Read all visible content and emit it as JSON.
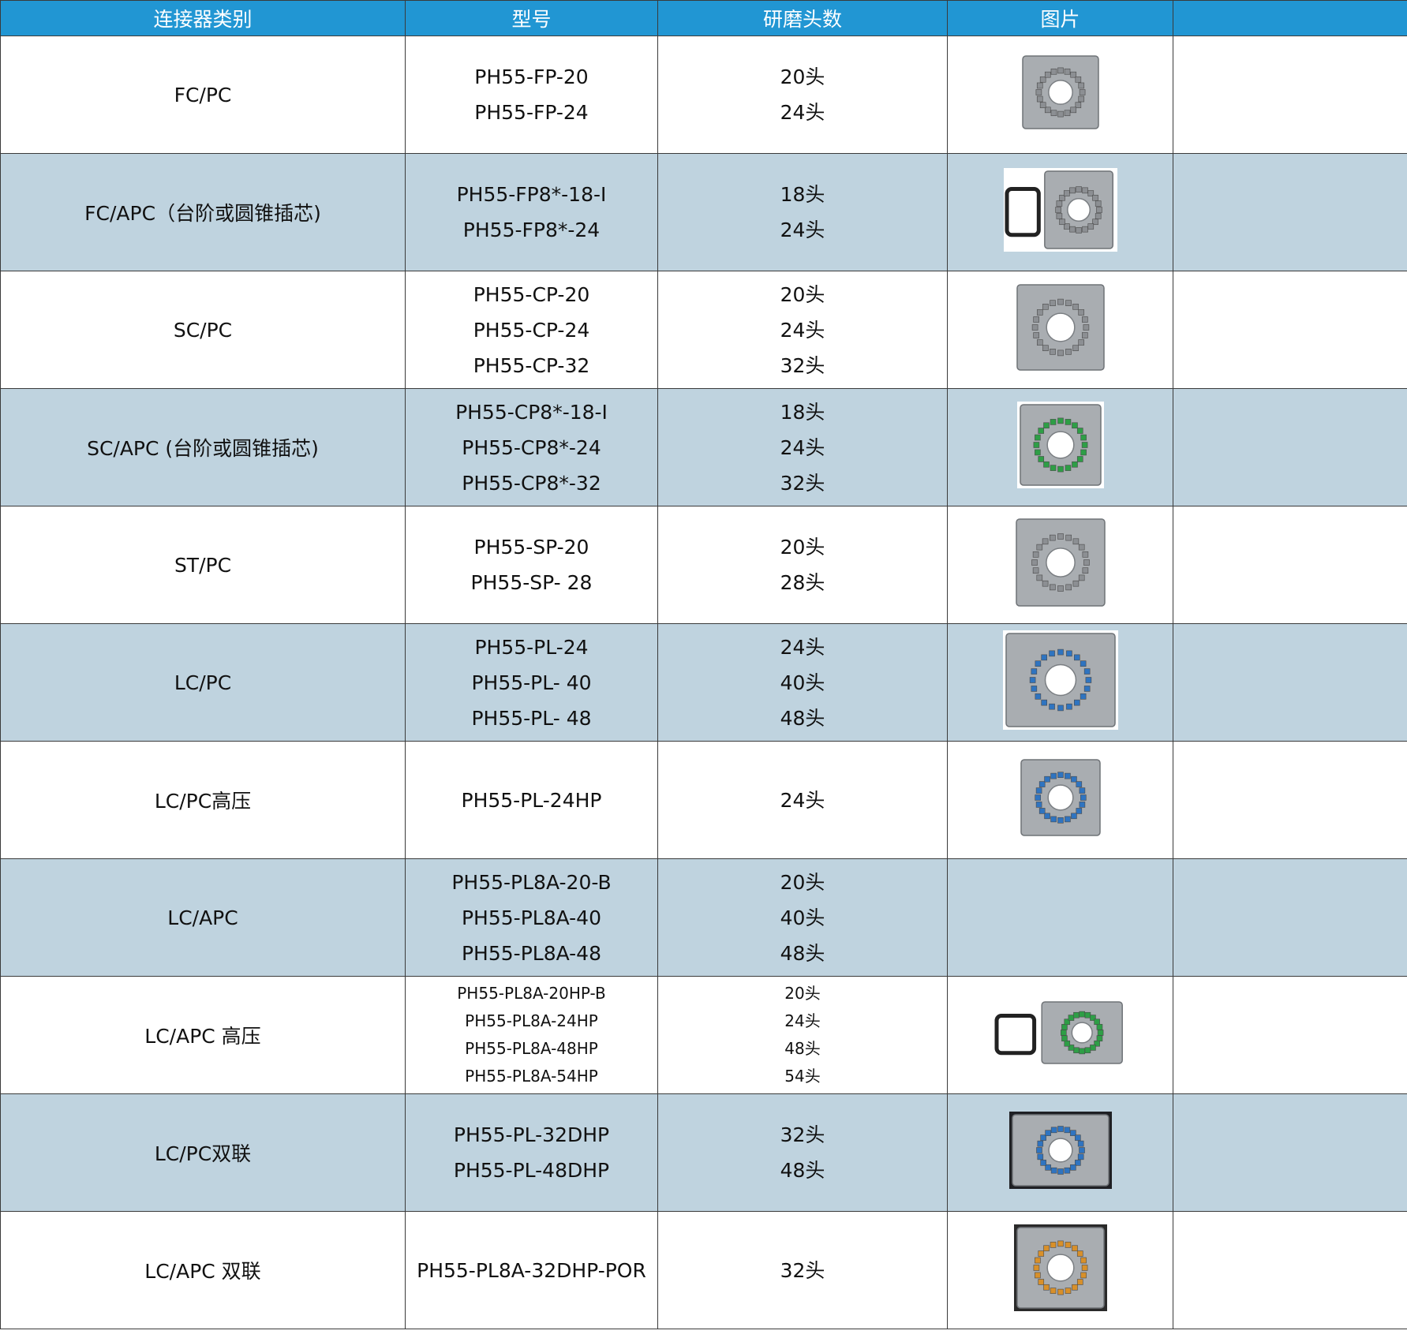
{
  "headers": [
    "连接器类别",
    "型号",
    "研磨头数",
    "图片",
    ""
  ],
  "rows": [
    {
      "category": "FC/PC",
      "models": [
        "PH55-FP-20",
        "PH55-FP-24"
      ],
      "heads": [
        "20头",
        "24头"
      ],
      "image": "fixture-photo-gray"
    },
    {
      "category": "FC/APC（台阶或圆锥插芯)",
      "models": [
        "PH55-FP8*-18-I",
        "PH55-FP8*-24"
      ],
      "heads": [
        "18头",
        "24头"
      ],
      "image": "fixture-photo-with-handle"
    },
    {
      "category": "SC/PC",
      "models": [
        "PH55-CP-20",
        "PH55-CP-24",
        "PH55-CP-32"
      ],
      "heads": [
        "20头",
        "24头",
        "32头"
      ],
      "image": "fixture-photo-gray"
    },
    {
      "category": "SC/APC (台阶或圆锥插芯)",
      "models": [
        "PH55-CP8*-18-I",
        "PH55-CP8*-24",
        "PH55-CP8*-32"
      ],
      "heads": [
        "18头",
        "24头",
        "32头"
      ],
      "image": "fixture-photo-green"
    },
    {
      "category": "ST/PC",
      "models": [
        "PH55-SP-20",
        "PH55-SP- 28"
      ],
      "heads": [
        "20头",
        "28头"
      ],
      "image": "fixture-photo-gray"
    },
    {
      "category": "LC/PC",
      "models": [
        "PH55-PL-24",
        "PH55-PL- 40",
        "PH55-PL- 48"
      ],
      "heads": [
        "24头",
        "40头",
        "48头"
      ],
      "image": "fixture-photo-blue"
    },
    {
      "category": "LC/PC高压",
      "models": [
        "PH55-PL-24HP"
      ],
      "heads": [
        "24头"
      ],
      "image": "fixture-photo-blue"
    },
    {
      "category": "LC/APC",
      "models": [
        "PH55-PL8A-20-B",
        "PH55-PL8A-40",
        "PH55-PL8A-48"
      ],
      "heads": [
        "20头",
        "40头",
        "48头"
      ],
      "image": ""
    },
    {
      "category": "LC/APC 高压",
      "models": [
        "PH55-PL8A-20HP-B",
        "PH55-PL8A-24HP",
        "PH55-PL8A-48HP",
        "PH55-PL8A-54HP"
      ],
      "heads": [
        "20头",
        "24头",
        "48头",
        "54头"
      ],
      "image": "fixture-photo-green-with-handle"
    },
    {
      "category": "LC/PC双联",
      "models": [
        "PH55-PL-32DHP",
        "PH55-PL-48DHP"
      ],
      "heads": [
        "32头",
        "48头"
      ],
      "image": "fixture-photo-dark"
    },
    {
      "category": "LC/APC 双联",
      "models": [
        "PH55-PL8A-32DHP-POR"
      ],
      "heads": [
        "32头"
      ],
      "image": "fixture-photo-orange"
    }
  ],
  "colors": {
    "header_bg": "#2196d3",
    "alt_row_bg": "#bfd3df",
    "plate": "#a9adb1",
    "ring_gray": "#8c8f93",
    "ring_green": "#2e9e46",
    "ring_blue": "#2f74c0",
    "ring_orange": "#d8902a"
  }
}
